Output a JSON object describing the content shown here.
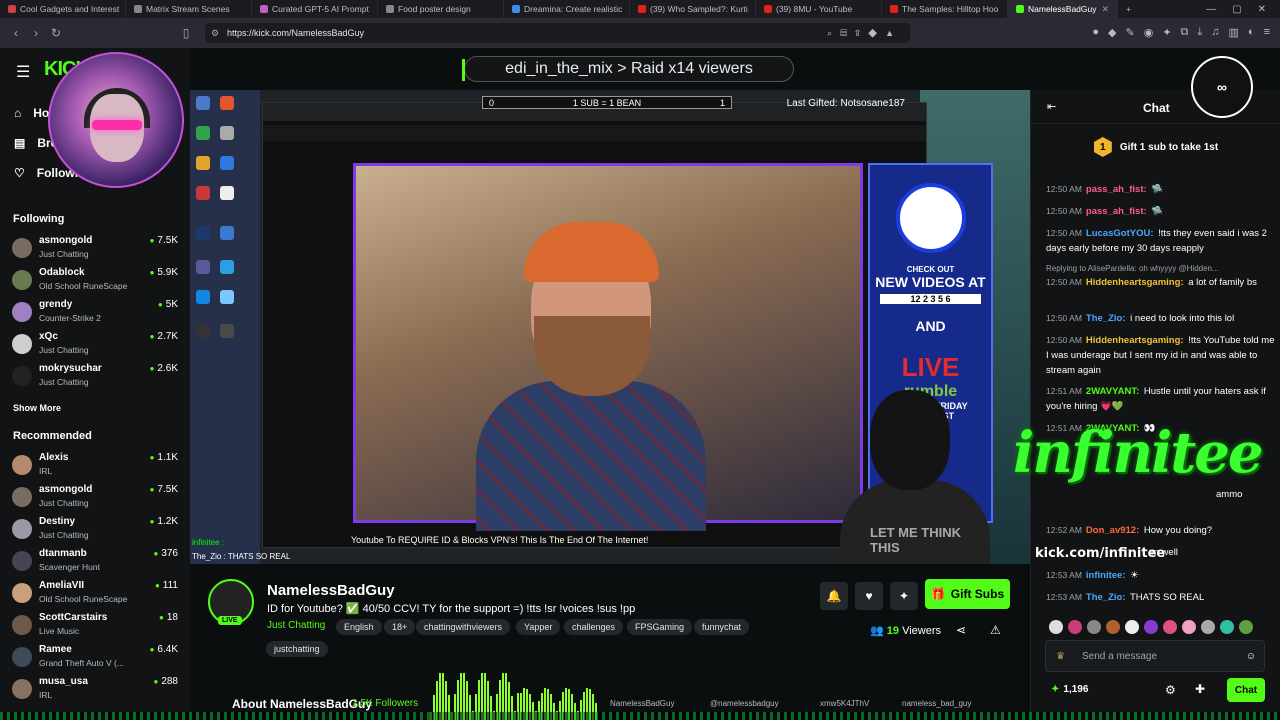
{
  "browser": {
    "tabs": [
      {
        "label": "Cool Gadgets and Interest",
        "color": "#d04040"
      },
      {
        "label": "Matrix Stream Scenes",
        "color": "#888888"
      },
      {
        "label": "Curated GPT-5 AI Prompt",
        "color": "#c060c0"
      },
      {
        "label": "Food poster design",
        "color": "#888888"
      },
      {
        "label": "Dreamina: Create realistic",
        "color": "#3a8ee6"
      },
      {
        "label": "(39) Who Sampled?: Kurti",
        "color": "#e62117"
      },
      {
        "label": "(39) 8MU - YouTube",
        "color": "#e62117"
      },
      {
        "label": "The Samples: Hilltop Hoo",
        "color": "#e62117"
      },
      {
        "label": "NamelessBadGuy",
        "color": "#53fc18"
      }
    ],
    "url": "https://kick.com/NamelessBadGuy"
  },
  "sidebar": {
    "nav": [
      {
        "label": "Home"
      },
      {
        "label": "Browse"
      },
      {
        "label": "Following"
      }
    ],
    "following_heading": "Following",
    "following": [
      {
        "name": "asmongold",
        "category": "Just Chatting",
        "viewers": "7.5K"
      },
      {
        "name": "Odablock",
        "category": "Old School RuneScape",
        "viewers": "5.9K"
      },
      {
        "name": "grendy",
        "category": "Counter-Strike 2",
        "viewers": "5K"
      },
      {
        "name": "xQc",
        "category": "Just Chatting",
        "viewers": "2.7K"
      },
      {
        "name": "mokrysuchar",
        "category": "Just Chatting",
        "viewers": "2.6K"
      }
    ],
    "show_more": "Show More",
    "recommended_heading": "Recommended",
    "recommended": [
      {
        "name": "Alexis",
        "category": "IRL",
        "viewers": "1.1K"
      },
      {
        "name": "asmongold",
        "category": "Just Chatting",
        "viewers": "7.5K"
      },
      {
        "name": "Destiny",
        "category": "Just Chatting",
        "viewers": "1.2K"
      },
      {
        "name": "dtanmanb",
        "category": "Scavenger Hunt",
        "viewers": "376"
      },
      {
        "name": "AmeliaVII",
        "category": "Old School RuneScape",
        "viewers": "111"
      },
      {
        "name": "ScottCarstairs",
        "category": "Live Music",
        "viewers": "18"
      },
      {
        "name": "Ramee",
        "category": "Grand Theft Auto V (...",
        "viewers": "6.4K"
      },
      {
        "name": "musa_usa",
        "category": "IRL",
        "viewers": "288"
      }
    ]
  },
  "stream": {
    "raid_overlay": "edi_in_the_mix > Raid x14 viewers",
    "sub_goal_left": "0",
    "sub_goal_mid": "1 SUB = 1 BEAN",
    "sub_goal_right": "1",
    "last_gifted": "Last Gifted: Notsosane187",
    "yt_video_title": "Youtube To REQUIRE ID & Blocks VPN's! This Is The End Of The Internet!",
    "promo_text_1": "CHECK OUT",
    "promo_text_2": "NEW VIDEOS AT",
    "promo_days": "12 2 3 5 6",
    "promo_and": "AND",
    "promo_live": "LIVE",
    "promo_rumble": "rumble",
    "promo_schedule": "MONDAY-FRIDAY",
    "promo_time": "@1PM EST",
    "ingame_chat_1": "infinitee :",
    "ingame_chat_2": "The_Zio : THATS SO REAL",
    "masked_shirt": "LET ME THINK THIS"
  },
  "channel": {
    "name": "NamelessBadGuy",
    "live": "LIVE",
    "title": "ID for Youtube? ✅ 40/50 CCV! TY for the support =)  !tts !sr !voices !sus !pp",
    "category": "Just Chatting",
    "tags": [
      "English",
      "18+",
      "chattingwithviewers",
      "Yapper",
      "challenges",
      "FPSGaming",
      "funnychat",
      "justchatting"
    ],
    "gift_subs": "Gift Subs",
    "viewers_count": "19",
    "viewers_label": "Viewers",
    "about": "About NamelessBadGuy",
    "followers": "1.5K Followers",
    "social_1": "NamelessBadGuy",
    "social_2": "@namelessbadguy",
    "social_3": "xmw5K4JThV",
    "social_4": "nameless_bad_guy"
  },
  "chat": {
    "title": "Chat",
    "gift_num": "1",
    "gift_banner": "Gift 1 sub to take 1st",
    "messages": [
      {
        "time": "12:50 AM",
        "user": "pass_ah_fist:",
        "color": "#ff5c8a",
        "text": "🛸"
      },
      {
        "time": "12:50 AM",
        "user": "pass_ah_fist:",
        "color": "#ff5c8a",
        "text": "🛸"
      },
      {
        "time": "12:50 AM",
        "user": "LucasGotYOU:",
        "color": "#4aa8ff",
        "text": "!tts they even said i was 2 days early before my 30 days reapply"
      },
      {
        "time": "12:50 AM",
        "user": "Hiddenheartsgaming:",
        "color": "#f0c23a",
        "text": "a lot of family bs"
      },
      {
        "time": "12:50 AM",
        "user": "The_Zio:",
        "color": "#4aa8ff",
        "text": "i need to look into this lol"
      },
      {
        "time": "12:50 AM",
        "user": "Hiddenheartsgaming:",
        "color": "#f0c23a",
        "text": "!tts YouTube told me I was underage but I sent my id in and was able to stream again"
      },
      {
        "time": "12:51 AM",
        "user": "2WAVYANT:",
        "color": "#53fc18",
        "text": "Hustle until your haters ask if you're hiring 💗💚"
      },
      {
        "time": "12:51 AM",
        "user": "2WAVYANT:",
        "color": "#53fc18",
        "text": "👀"
      },
      {
        "time": "12:52 AM",
        "user": "Don_av912:",
        "color": "#ff6a3a",
        "text": "How you doing?"
      },
      {
        "time": "12:53 AM",
        "user": "infinitee:",
        "color": "#4aa8ff",
        "text": "☀"
      },
      {
        "time": "12:53 AM",
        "user": "The_Zio:",
        "color": "#4aa8ff",
        "text": "THATS SO REAL"
      }
    ],
    "reply_text": "Replying to AlisePardella: oh whyyyy @Hidden...",
    "ammo_text": "ammo",
    "well_text": "m well",
    "infinitee_overlay": "infinitee",
    "infinitee_url": "kick.com/infinitee",
    "send_placeholder": "Send a message",
    "points": "1,196",
    "chat_button": "Chat"
  }
}
